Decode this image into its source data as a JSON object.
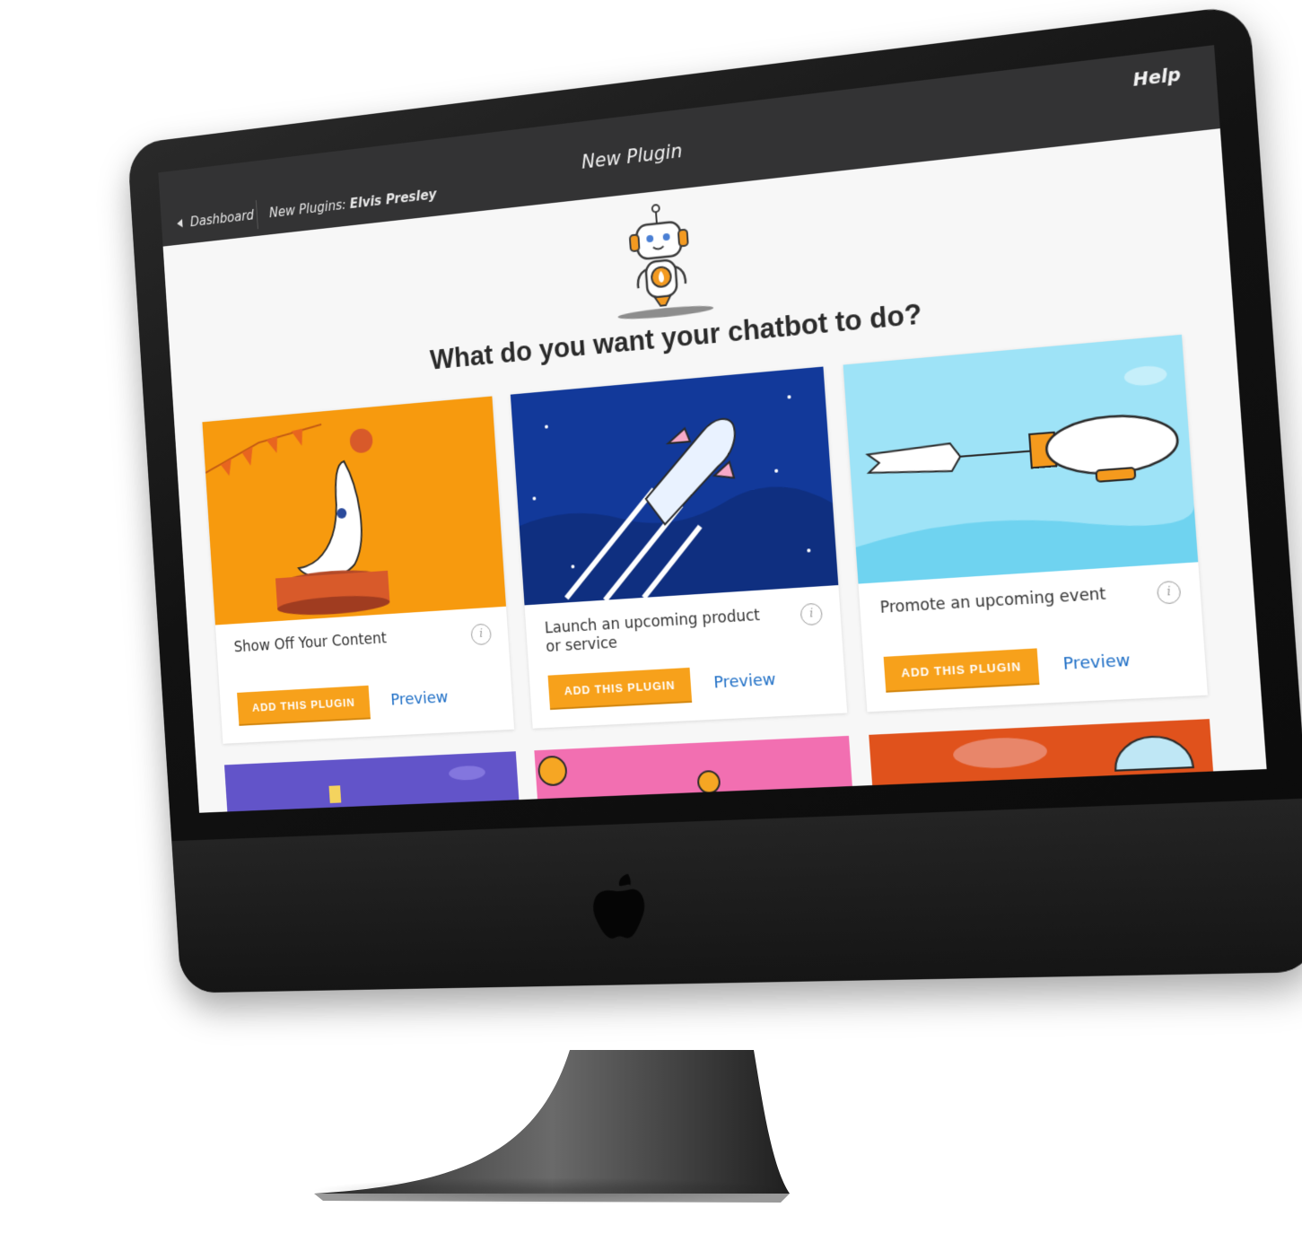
{
  "topbar": {
    "back_label": "Dashboard",
    "breadcrumb_prefix": "New Plugins:",
    "breadcrumb_name": "Elvis Presley",
    "title": "New Plugin",
    "help_label": "Help"
  },
  "main": {
    "question": "What do you want your chatbot to do?"
  },
  "cards": [
    {
      "title": "Show Off Your Content",
      "button_label": "ADD THIS PLUGIN",
      "preview_label": "Preview",
      "art": "circus-seal",
      "bg": "#f79a0e"
    },
    {
      "title": "Launch an upcoming product or service",
      "button_label": "ADD THIS PLUGIN",
      "preview_label": "Preview",
      "art": "rocket-launch",
      "bg": "#12399a"
    },
    {
      "title": "Promote an upcoming event",
      "button_label": "ADD THIS PLUGIN",
      "preview_label": "Preview",
      "art": "blimp-banner",
      "bg": "#9ee3f7"
    }
  ],
  "partial_cards": [
    {
      "art": "night-scene",
      "bg": "#6254c9"
    },
    {
      "art": "coins",
      "bg": "#f26fb1"
    },
    {
      "art": "parachutes",
      "bg": "#e0521c"
    }
  ],
  "icons": {
    "back": "triangle-left-icon",
    "info": "info-circle-icon",
    "brand": "apple-logo-icon"
  },
  "colors": {
    "accent": "#f7a11b",
    "link": "#1f6fc6",
    "topbar": "#333334"
  }
}
